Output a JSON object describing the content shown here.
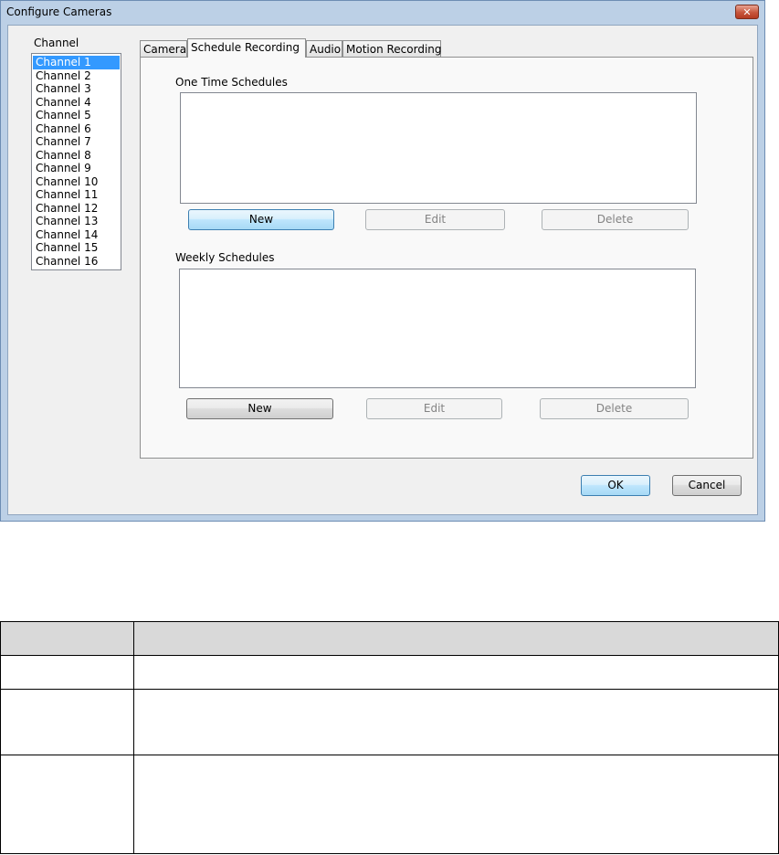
{
  "window": {
    "title": "Configure Cameras",
    "close_glyph": "✕"
  },
  "channels": {
    "label": "Channel",
    "items": [
      "Channel 1",
      "Channel 2",
      "Channel 3",
      "Channel 4",
      "Channel 5",
      "Channel 6",
      "Channel 7",
      "Channel 8",
      "Channel 9",
      "Channel 10",
      "Channel 11",
      "Channel 12",
      "Channel 13",
      "Channel 14",
      "Channel 15",
      "Channel 16"
    ],
    "selected": "Channel 1"
  },
  "tabs": [
    "Camera",
    "Schedule Recording",
    "Audio",
    "Motion Recording"
  ],
  "active_tab": "Schedule Recording",
  "one_time": {
    "label": "One Time Schedules",
    "new": "New",
    "edit": "Edit",
    "delete": "Delete"
  },
  "weekly": {
    "label": "Weekly Schedules",
    "new": "New",
    "edit": "Edit",
    "delete": "Delete"
  },
  "footer": {
    "ok": "OK",
    "cancel": "Cancel"
  },
  "colors": {
    "selection": "#3399ff",
    "table_header": "#d9d9d9"
  }
}
